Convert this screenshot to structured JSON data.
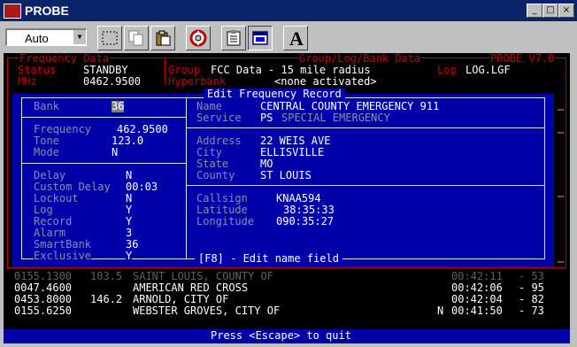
{
  "window": {
    "title": "PROBE",
    "min_glyph": "_",
    "max_glyph": "□",
    "close_glyph": "×"
  },
  "toolbar": {
    "font_value": "Auto",
    "buttons": [
      "select-icon",
      "copy-icon",
      "paste-icon",
      "lifebuoy-icon",
      "clipboard-icon",
      "window-icon",
      "font-icon"
    ],
    "font_button_glyph": "A"
  },
  "frames": {
    "frequency_data": "Frequency Data",
    "group_bank_data": "Group/Log/Bank Data",
    "version": "PROBE V7.0"
  },
  "status": {
    "status_label": "Status",
    "status_value": "STANDBY",
    "mhz_label": "MHz",
    "mhz_value": "0462.9500",
    "group_label": "Group",
    "group_value": "FCC Data - 15 mile radius",
    "hyperbank_label": "Hyperbank",
    "hyperbank_value": "<none activated>",
    "log_label": "Log",
    "log_value": "LOG.LGF"
  },
  "dialog": {
    "title": "Edit Frequency Record",
    "footer": "[F8] - Edit name field",
    "bank_label": "Bank",
    "bank_value": "36",
    "frequency_label": "Frequency",
    "frequency_value": "462.9500",
    "tone_label": "Tone",
    "tone_value": "123.0",
    "mode_label": "Mode",
    "mode_value": "N",
    "delay_label": "Delay",
    "delay_value": "N",
    "custom_delay_label": "Custom Delay",
    "custom_delay_value": "00:03",
    "lockout_label": "Lockout",
    "lockout_value": "N",
    "log_label": "Log",
    "log_value": "Y",
    "record_label": "Record",
    "record_value": "Y",
    "alarm_label": "Alarm",
    "alarm_value": "3",
    "smartbank_label": "SmartBank",
    "smartbank_value": "36",
    "exclusive_label": "Exclusive",
    "exclusive_value": "Y",
    "name_label": "Name",
    "name_value": "CENTRAL COUNTY EMERGENCY 911",
    "service_label": "Service",
    "service_code": "PS",
    "service_value": "SPECIAL EMERGENCY",
    "address_label": "Address",
    "address_value": "22 WEIS AVE",
    "city_label": "City",
    "city_value": "ELLISVILLE",
    "state_label": "State",
    "state_value": "MO",
    "county_label": "County",
    "county_value": "ST LOUIS",
    "callsign_label": "Callsign",
    "callsign_value": "KNAA594",
    "latitude_label": "Latitude",
    "latitude_value": "38:35:33",
    "longitude_label": "Longitude",
    "longitude_value": "090:35:27"
  },
  "list": [
    {
      "freq": "0155.1300",
      "tone": "103.5",
      "name": "SAINT LOUIS, COUNTY OF",
      "flag": "",
      "time": "00:42:11",
      "level": "- 53"
    },
    {
      "freq": "0047.4600",
      "tone": "",
      "name": "AMERICAN RED CROSS",
      "flag": "",
      "time": "00:42:06",
      "level": "- 95"
    },
    {
      "freq": "0453.8000",
      "tone": "146.2",
      "name": "ARNOLD, CITY OF",
      "flag": "",
      "time": "00:42:04",
      "level": "- 82"
    },
    {
      "freq": "0155.6250",
      "tone": "",
      "name": "WEBSTER GROVES, CITY OF",
      "flag": "N",
      "time": "00:41:50",
      "level": "- 73"
    }
  ],
  "footer": "Press <Escape> to quit",
  "colors": {
    "console_bg": "#000000",
    "dialog_bg": "#0000a8",
    "frame_red": "#c00000",
    "title_bar": "#0a246a"
  }
}
